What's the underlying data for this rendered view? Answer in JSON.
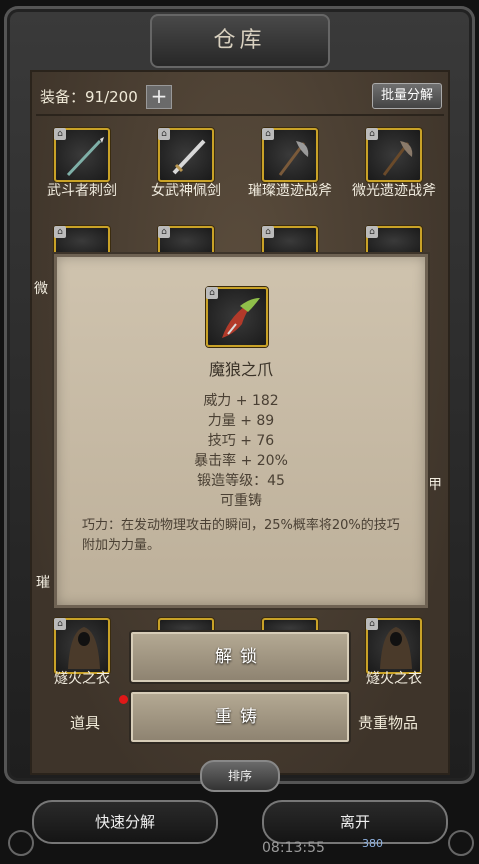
{
  "window": {
    "title": "仓库"
  },
  "toolbar": {
    "equip_label": "装备：91/200",
    "add_symbol": "+",
    "batch_label": "批量分解"
  },
  "grid_row1": [
    {
      "name": "武斗者刺剑",
      "icon": "spear-icon"
    },
    {
      "name": "女武神佩剑",
      "icon": "sword-icon"
    },
    {
      "name": "璀璨遗迹战斧",
      "icon": "axe-icon"
    },
    {
      "name": "微光遗迹战斧",
      "icon": "axe-icon"
    }
  ],
  "partial_labels": {
    "left_r2": "微",
    "right_r4": "甲",
    "left_r5": "璀"
  },
  "grid_bottom": [
    {
      "name": "燧火之衣",
      "icon": "hooded-robe-icon"
    },
    {
      "name": "燧火之衣",
      "icon": "hooded-robe-icon"
    }
  ],
  "popup": {
    "item_name": "魔狼之爪",
    "item_icon": "claw-icon",
    "stats": [
      "威力 + 182",
      "力量 + 89",
      "技巧 + 76",
      "暴击率 + 20%",
      "锻造等级：45",
      "可重铸"
    ],
    "description": "巧力：在发动物理攻击的瞬间，25%概率将20%的技巧附加为力量。"
  },
  "actions": {
    "unlock_label": "解锁",
    "reforge_label": "重铸"
  },
  "tabs": {
    "items_label": "道具",
    "valuables_label": "贵重物品"
  },
  "sort_label": "排序",
  "footer": {
    "quick_dismantle": "快速分解",
    "leave": "离开"
  },
  "status": {
    "time": "08:13:55",
    "badge": "380"
  },
  "colors": {
    "slot_border": "#c9a227",
    "popup_bg": "#c8bca8",
    "red_dot": "#e01818"
  }
}
